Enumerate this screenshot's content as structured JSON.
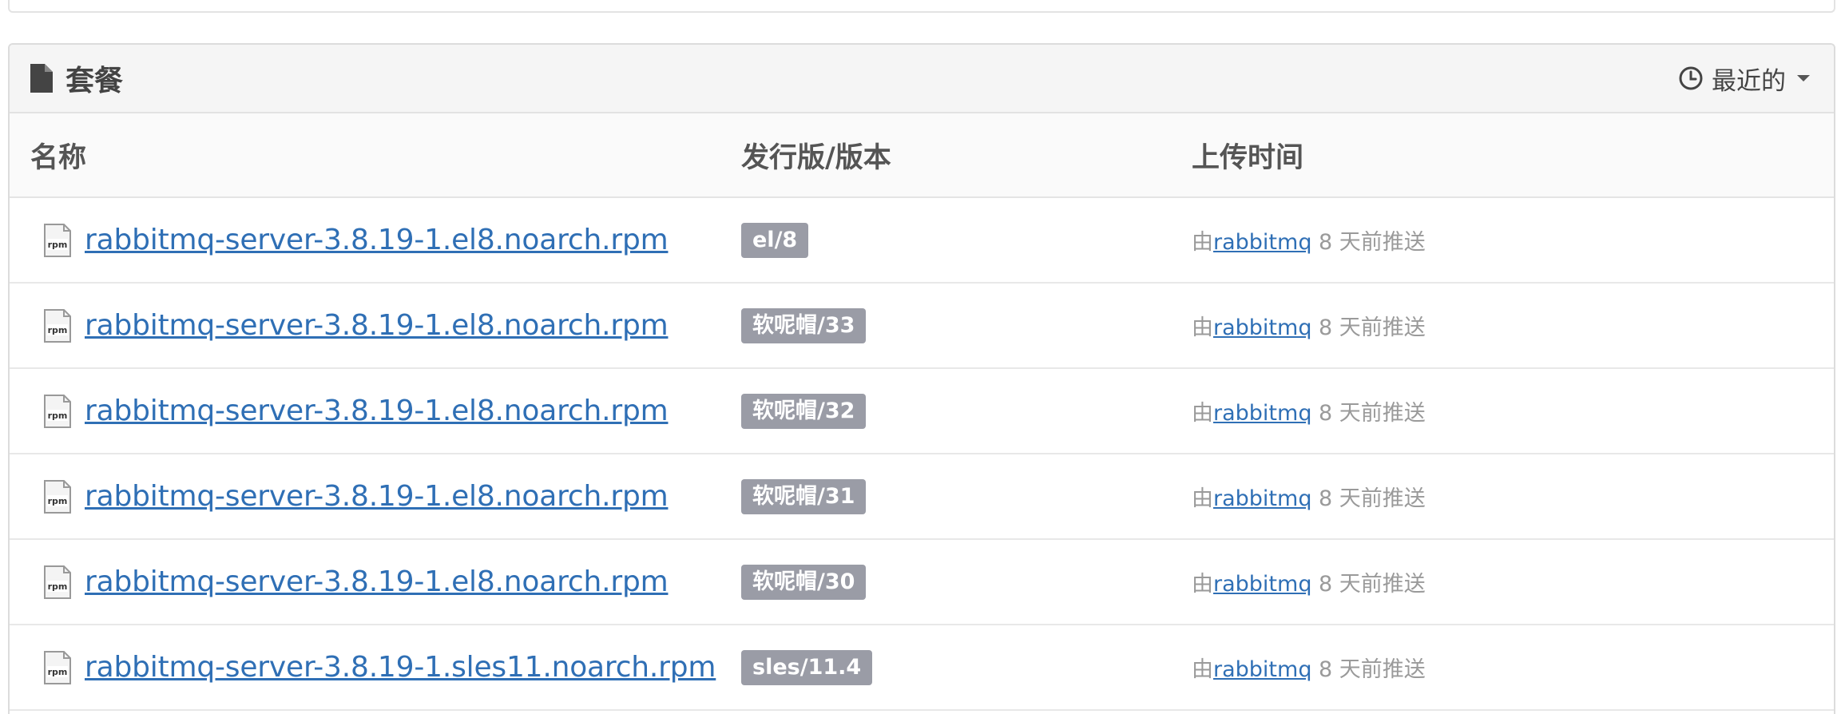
{
  "panel": {
    "title": "套餐",
    "sort_label": "最近的"
  },
  "table": {
    "headers": {
      "name": "名称",
      "distro": "发行版/版本",
      "uploaded": "上传时间"
    },
    "rows": [
      {
        "name": "rabbitmq-server-3.8.19-1.el8.noarch.rpm",
        "distro": "el/8",
        "by": "由",
        "user": "rabbitmq",
        "when": " 8 天前推送"
      },
      {
        "name": "rabbitmq-server-3.8.19-1.el8.noarch.rpm",
        "distro": "软呢帽/33",
        "by": "由",
        "user": "rabbitmq",
        "when": " 8 天前推送"
      },
      {
        "name": "rabbitmq-server-3.8.19-1.el8.noarch.rpm",
        "distro": "软呢帽/32",
        "by": "由",
        "user": "rabbitmq",
        "when": " 8 天前推送"
      },
      {
        "name": "rabbitmq-server-3.8.19-1.el8.noarch.rpm",
        "distro": "软呢帽/31",
        "by": "由",
        "user": "rabbitmq",
        "when": " 8 天前推送"
      },
      {
        "name": "rabbitmq-server-3.8.19-1.el8.noarch.rpm",
        "distro": "软呢帽/30",
        "by": "由",
        "user": "rabbitmq",
        "when": " 8 天前推送"
      },
      {
        "name": "rabbitmq-server-3.8.19-1.sles11.noarch.rpm",
        "distro": "sles/11.4",
        "by": "由",
        "user": "rabbitmq",
        "when": " 8 天前推送"
      }
    ]
  },
  "colors": {
    "link": "#2f6fb5",
    "badge_bg": "#9a9ca6",
    "header_bg": "#f5f5f5"
  },
  "icons": {
    "title_icon": "file-icon",
    "sort_icon": "clock-icon",
    "row_icon": "rpm-file-icon"
  }
}
